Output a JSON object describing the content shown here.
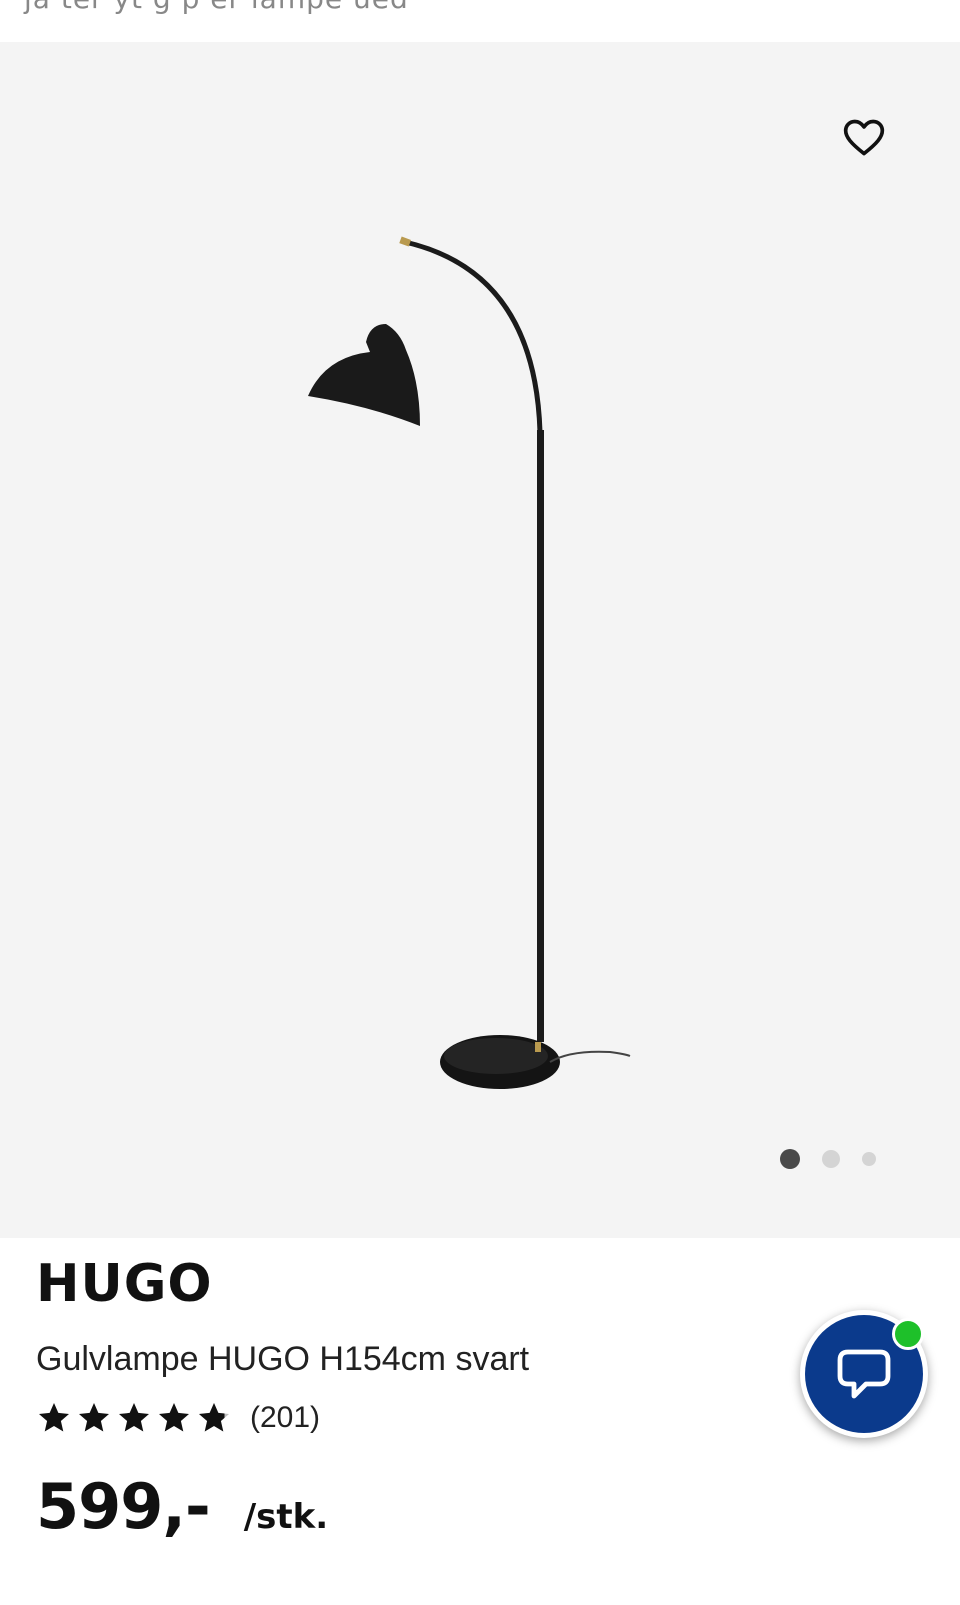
{
  "top_bar": {
    "truncated_text": "ja      ter       yt g      p       er   lampe  ued"
  },
  "gallery": {
    "favorite_icon": "heart-outline-icon",
    "image_alt": "Gulvlampe HUGO H154cm svart",
    "pagination": {
      "total": 3,
      "active": 1
    }
  },
  "product": {
    "brand": "HUGO",
    "description": "Gulvlampe HUGO H154cm svart",
    "rating": 4.8,
    "rating_max": 5,
    "review_count": "(201)",
    "price": "599,-",
    "unit": "/stk."
  },
  "chat": {
    "icon": "chat-bubble-icon",
    "status_color": "#1ec02a",
    "brand_color": "#0b3a8c"
  }
}
